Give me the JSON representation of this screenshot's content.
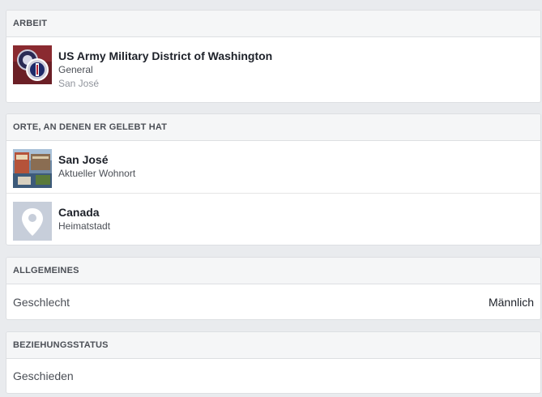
{
  "work": {
    "header": "ARBEIT",
    "items": [
      {
        "title": "US Army Military District of Washington",
        "position": "General",
        "location": "San José",
        "icon": "military-insignia-thumbnail"
      }
    ]
  },
  "places": {
    "header": "ORTE, AN DENEN ER GELEBT HAT",
    "items": [
      {
        "title": "San José",
        "subtitle": "Aktueller Wohnort",
        "icon": "city-photo-thumbnail"
      },
      {
        "title": "Canada",
        "subtitle": "Heimatstadt",
        "icon": "map-pin-icon"
      }
    ]
  },
  "general": {
    "header": "ALLGEMEINES",
    "label": "Geschlecht",
    "value": "Männlich"
  },
  "relationship": {
    "header": "BEZIEHUNGSSTATUS",
    "value": "Geschieden"
  },
  "colors": {
    "background": "#e9ebee",
    "header_bg": "#f5f6f7",
    "pin_bg": "#bec3c9"
  }
}
